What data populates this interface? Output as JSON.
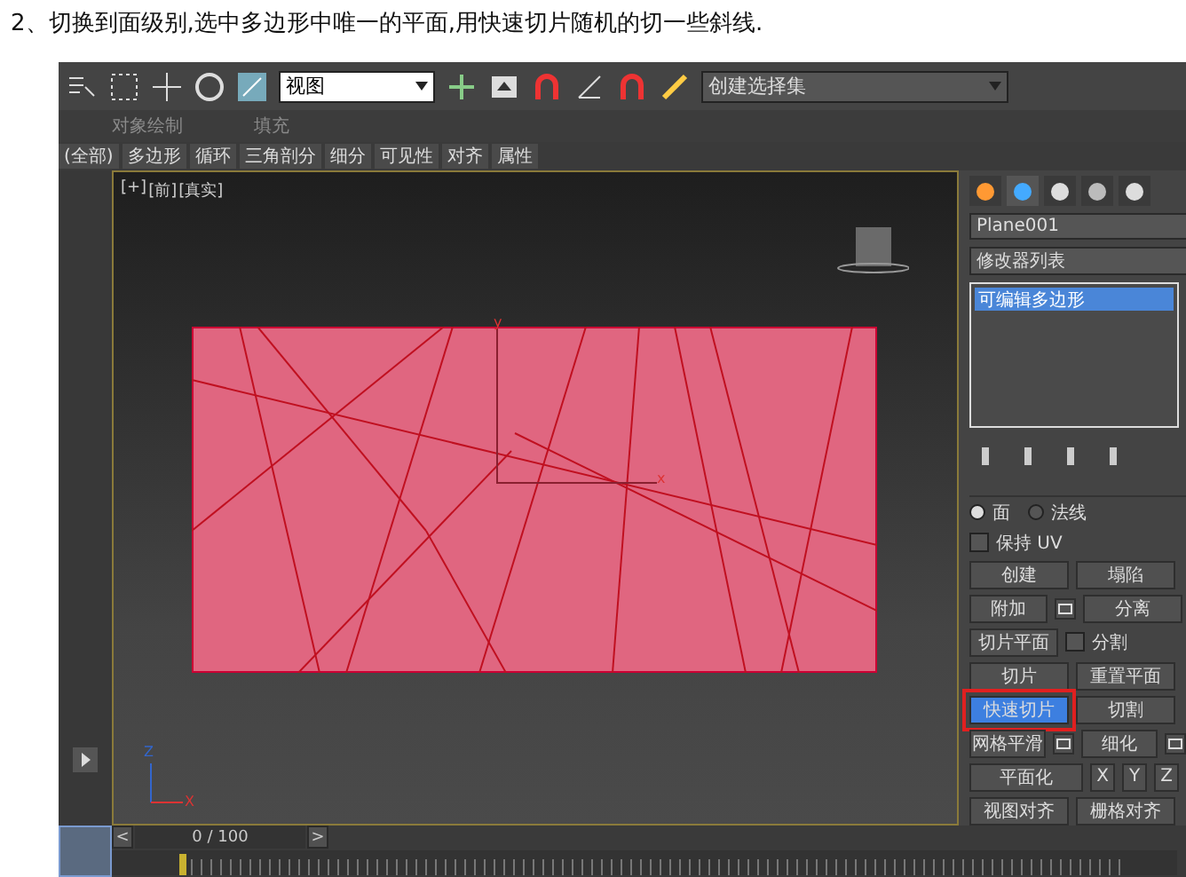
{
  "heading": "2、切换到面级别,选中多边形中唯一的平面,用快速切片随机的切一些斜线.",
  "toolbar": {
    "view_dropdown": "视图",
    "selection_set_dropdown": "创建选择集"
  },
  "subbar": [
    "对象绘制",
    "填充"
  ],
  "ribbon_tabs": [
    {
      "label": "(全部)",
      "selected": false
    },
    {
      "label": "多边形",
      "selected": false
    },
    {
      "label": "循环",
      "selected": false
    },
    {
      "label": "三角剖分",
      "selected": false
    },
    {
      "label": "细分",
      "selected": false
    },
    {
      "label": "可见性",
      "selected": false
    },
    {
      "label": "对齐",
      "selected": false
    },
    {
      "label": "属性",
      "selected": false
    }
  ],
  "viewport": {
    "labels": [
      "[+]",
      "[前]",
      "[真实]"
    ],
    "plane_axes": [
      "y",
      "x"
    ],
    "gizmo_axes": [
      "Z",
      "X"
    ]
  },
  "command_panel": {
    "object_name": "Plane001",
    "modifier_list": "修改器列表",
    "stack": [
      {
        "label": "可编辑多边形",
        "selected": true
      }
    ],
    "rows": [
      {
        "kind": "radios",
        "items": [
          {
            "label": "面",
            "selected": true
          },
          {
            "label": "法线",
            "selected": false
          }
        ]
      },
      {
        "kind": "check",
        "label": "保持 UV",
        "checked": false
      },
      {
        "kind": "buttons",
        "items": [
          {
            "label": "创建",
            "selected": false
          },
          {
            "label": "塌陷",
            "selected": false
          }
        ]
      },
      {
        "kind": "buttons",
        "items": [
          {
            "label": "附加",
            "selected": false,
            "settings": true
          },
          {
            "label": "分离",
            "selected": false
          }
        ]
      },
      {
        "kind": "check_button",
        "button": {
          "label": "切片平面",
          "selected": false
        },
        "label": "分割",
        "checked": false
      },
      {
        "kind": "buttons",
        "items": [
          {
            "label": "切片",
            "selected": false
          },
          {
            "label": "重置平面",
            "selected": false
          }
        ]
      },
      {
        "kind": "buttons",
        "items": [
          {
            "label": "快速切片",
            "selected": true
          },
          {
            "label": "切割",
            "selected": false
          }
        ]
      },
      {
        "kind": "buttons",
        "items": [
          {
            "label": "网格平滑",
            "selected": false,
            "settings": true
          },
          {
            "label": "细化",
            "selected": false,
            "settings": true
          }
        ]
      },
      {
        "kind": "planar",
        "label": "平面化",
        "axes": [
          "X",
          "Y",
          "Z"
        ]
      },
      {
        "kind": "buttons",
        "items": [
          {
            "label": "视图对齐",
            "selected": false
          },
          {
            "label": "栅格对齐",
            "selected": false
          }
        ]
      }
    ]
  },
  "timeline": {
    "frame": "0 / 100",
    "prev": "<",
    "next": ">"
  }
}
